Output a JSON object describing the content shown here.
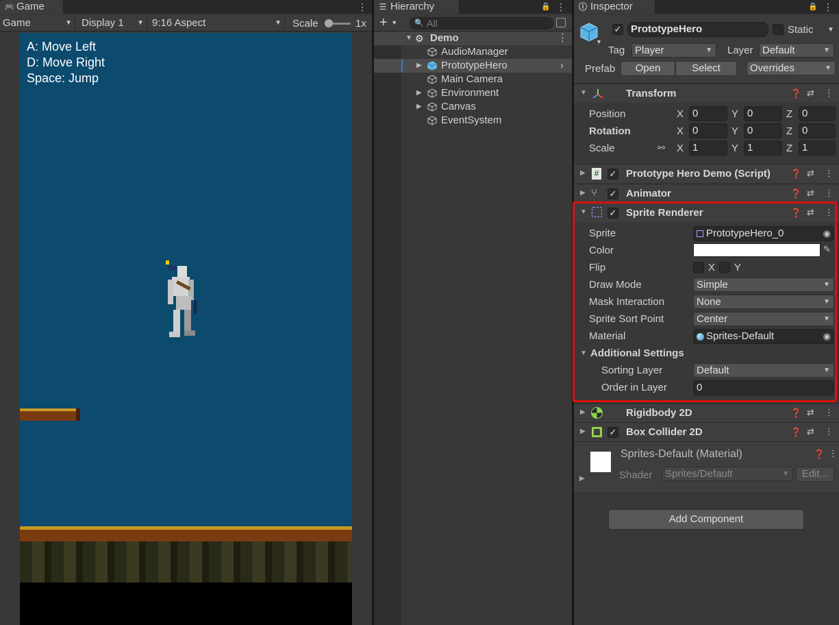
{
  "game_panel": {
    "tab_label": "Game",
    "mode_dropdown": "Game",
    "display_dropdown": "Display 1",
    "aspect_dropdown": "9:16 Aspect",
    "scale_label": "Scale",
    "scale_value": "1x",
    "instructions": [
      "A: Move Left",
      "D: Move Right",
      "Space: Jump"
    ],
    "colors": {
      "sky": "#0c4a6e",
      "ground_dark": "#000000"
    }
  },
  "hierarchy": {
    "tab_label": "Hierarchy",
    "search_placeholder": "All",
    "add_symbol": "+",
    "scene": "Demo",
    "items": [
      {
        "label": "AudioManager",
        "expandable": false,
        "selected": false
      },
      {
        "label": "PrototypeHero",
        "expandable": true,
        "selected": true
      },
      {
        "label": "Main Camera",
        "expandable": false,
        "selected": false
      },
      {
        "label": "Environment",
        "expandable": true,
        "selected": false
      },
      {
        "label": "Canvas",
        "expandable": true,
        "selected": false
      },
      {
        "label": "EventSystem",
        "expandable": false,
        "selected": false
      }
    ]
  },
  "inspector": {
    "tab_label": "Inspector",
    "object_name": "PrototypeHero",
    "static_label": "Static",
    "tag_label": "Tag",
    "tag_value": "Player",
    "layer_label": "Layer",
    "layer_value": "Default",
    "prefab_label": "Prefab",
    "open_button": "Open",
    "select_button": "Select",
    "overrides_dropdown": "Overrides",
    "transform": {
      "title": "Transform",
      "rows": [
        {
          "label": "Position",
          "x": "0",
          "y": "0",
          "z": "0"
        },
        {
          "label": "Rotation",
          "x": "0",
          "y": "0",
          "z": "0"
        },
        {
          "label": "Scale",
          "x": "1",
          "y": "1",
          "z": "1"
        }
      ],
      "axis_labels": [
        "X",
        "Y",
        "Z"
      ]
    },
    "script_component": "Prototype Hero Demo (Script)",
    "animator_component": "Animator",
    "sprite_renderer": {
      "title": "Sprite Renderer",
      "sprite_label": "Sprite",
      "sprite_value": "PrototypeHero_0",
      "color_label": "Color",
      "color_value": "#ffffff",
      "flip_label": "Flip",
      "flip_x": "X",
      "flip_y": "Y",
      "draw_mode_label": "Draw Mode",
      "draw_mode_value": "Simple",
      "mask_label": "Mask Interaction",
      "mask_value": "None",
      "sort_point_label": "Sprite Sort Point",
      "sort_point_value": "Center",
      "material_label": "Material",
      "material_value": "Sprites-Default",
      "additional_label": "Additional Settings",
      "sorting_layer_label": "Sorting Layer",
      "sorting_layer_value": "Default",
      "order_label": "Order in Layer",
      "order_value": "0",
      "highlight_color": "#e01010"
    },
    "rigidbody_component": "Rigidbody 2D",
    "box_collider_component": "Box Collider 2D",
    "material_asset": {
      "name": "Sprites-Default (Material)",
      "shader_label": "Shader",
      "shader_value": "Sprites/Default",
      "edit_button": "Edit..."
    },
    "add_component_button": "Add Component"
  }
}
